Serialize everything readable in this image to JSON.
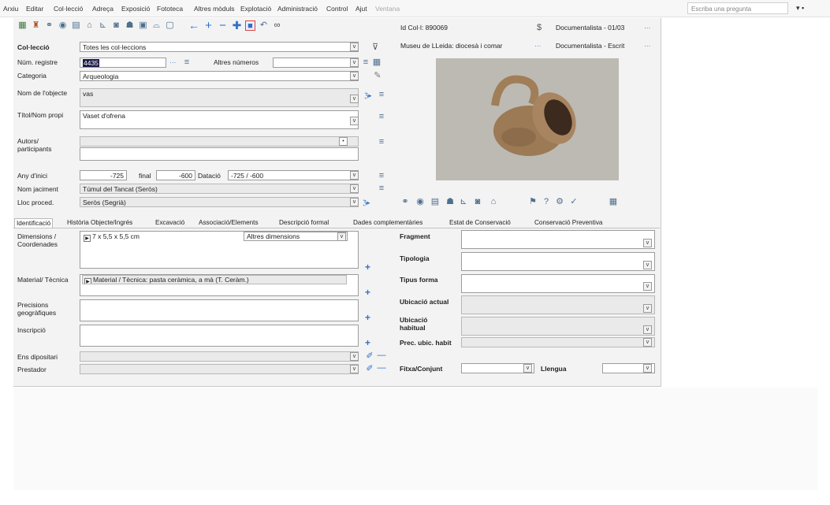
{
  "menu": [
    "Arxiu",
    "Editar",
    "Col·lecció",
    "Adreça",
    "Exposició",
    "Fototeca",
    "Altres mòduls",
    "Explotació",
    "Administració",
    "Control",
    "Ajut",
    "Ventana"
  ],
  "search_box": {
    "placeholder": "Escriba una pregunta"
  },
  "toolbar": {
    "icons": [
      "grid-icon",
      "person-icon",
      "link-icon",
      "eye-icon",
      "document-icon",
      "house-icon",
      "chart-icon",
      "camera-icon",
      "group-icon",
      "image-icon",
      "stamp-icon",
      "clipboard-icon",
      "arrow-left-icon",
      "add-icon",
      "remove-icon",
      "plus-cross-icon",
      "record-icon",
      "undo-icon",
      "binoculars-icon"
    ]
  },
  "header": {
    "id_col": "Id Col·l: 890069",
    "user_top": "Documentalista - 01/03",
    "museum": "Museu de LLeida: diocesà i comar",
    "user_bottom": "Documentalista - Escrit",
    "more": "···"
  },
  "form": {
    "coleccio_label": "Col·lecció",
    "coleccio_value": "Totes les col·leccions",
    "num_registre_label": "Núm. registre",
    "num_registre_value": "4435",
    "altres_numeros_label": "Altres números",
    "categoria_label": "Categoria",
    "categoria_value": "Arqueologia",
    "nom_objecte_label": "Nom de l'objecte",
    "nom_objecte_value": "vas",
    "titol_label": "Títol/Nom propi",
    "titol_value": "Vaset d'ofrena",
    "autors_label": "Autors/ participants",
    "any_inici_label": "Any d'inici",
    "any_inici_value": "-725",
    "final_label": "final",
    "final_value": "-600",
    "datacio_label": "Datació",
    "datacio_value": "-725 / -600",
    "nom_jaciment_label": "Nom jaciment",
    "nom_jaciment_value": "Túmul del Tancat (Seròs)",
    "lloc_proced_label": "Lloc proced.",
    "lloc_proced_value": "Seròs (Segrià)"
  },
  "tabs": [
    "Identificació",
    "Història Objecte/Ingrés",
    "Excavació",
    "Associació/Elements",
    "Descripció formal",
    "Dades complementàries",
    "Estat de Conservació",
    "Conservació Preventiva"
  ],
  "ident": {
    "dimensions_label": "Dimensions / Coordenades",
    "dimensions_value": "7 x 5,5 x 5,5 cm",
    "altres_dimensions": "Altres dimensions",
    "material_label": "Material/ Tècnica",
    "material_value": "Material / Tècnica: pasta ceràmica, a mà (T. Ceràm.)",
    "precisions_label": "Precisions geogràfiques",
    "inscripcio_label": "Inscripció",
    "ens_label": "Ens dipositari",
    "prestador_label": "Prestador",
    "fragment_label": "Fragment",
    "tipologia_label": "Tipologia",
    "tipus_forma_label": "Tipus forma",
    "ubicacio_actual_label": "Ubicació actual",
    "ubicacio_habitual_label": "Ubicació habitual",
    "prec_ubic_label": "Prec. ubic. habit",
    "fitxa_label": "Fitxa/Conjunt",
    "llengua_label": "Llengua"
  }
}
